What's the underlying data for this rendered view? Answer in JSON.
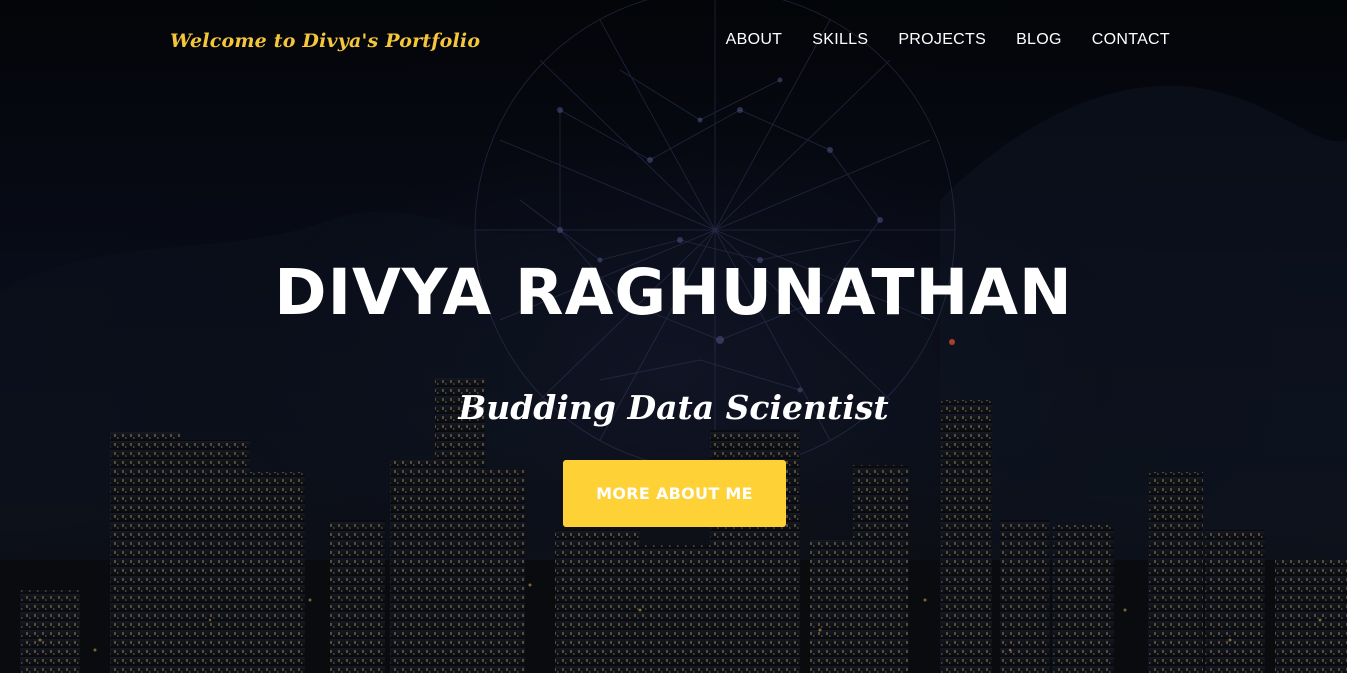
{
  "navbar": {
    "brand": "Welcome to Divya's Portfolio",
    "items": [
      {
        "label": "ABOUT"
      },
      {
        "label": "SKILLS"
      },
      {
        "label": "PROJECTS"
      },
      {
        "label": "BLOG"
      },
      {
        "label": "CONTACT"
      }
    ]
  },
  "hero": {
    "title": "DIVYA RAGHUNATHAN",
    "subtitle": "Budding Data Scientist",
    "cta_label": "MORE ABOUT ME",
    "background": "night-city-skyline-with-network-globe"
  },
  "colors": {
    "accent": "#fed136",
    "brand": "#f5c63b",
    "text": "#ffffff",
    "background": "#05070c"
  }
}
